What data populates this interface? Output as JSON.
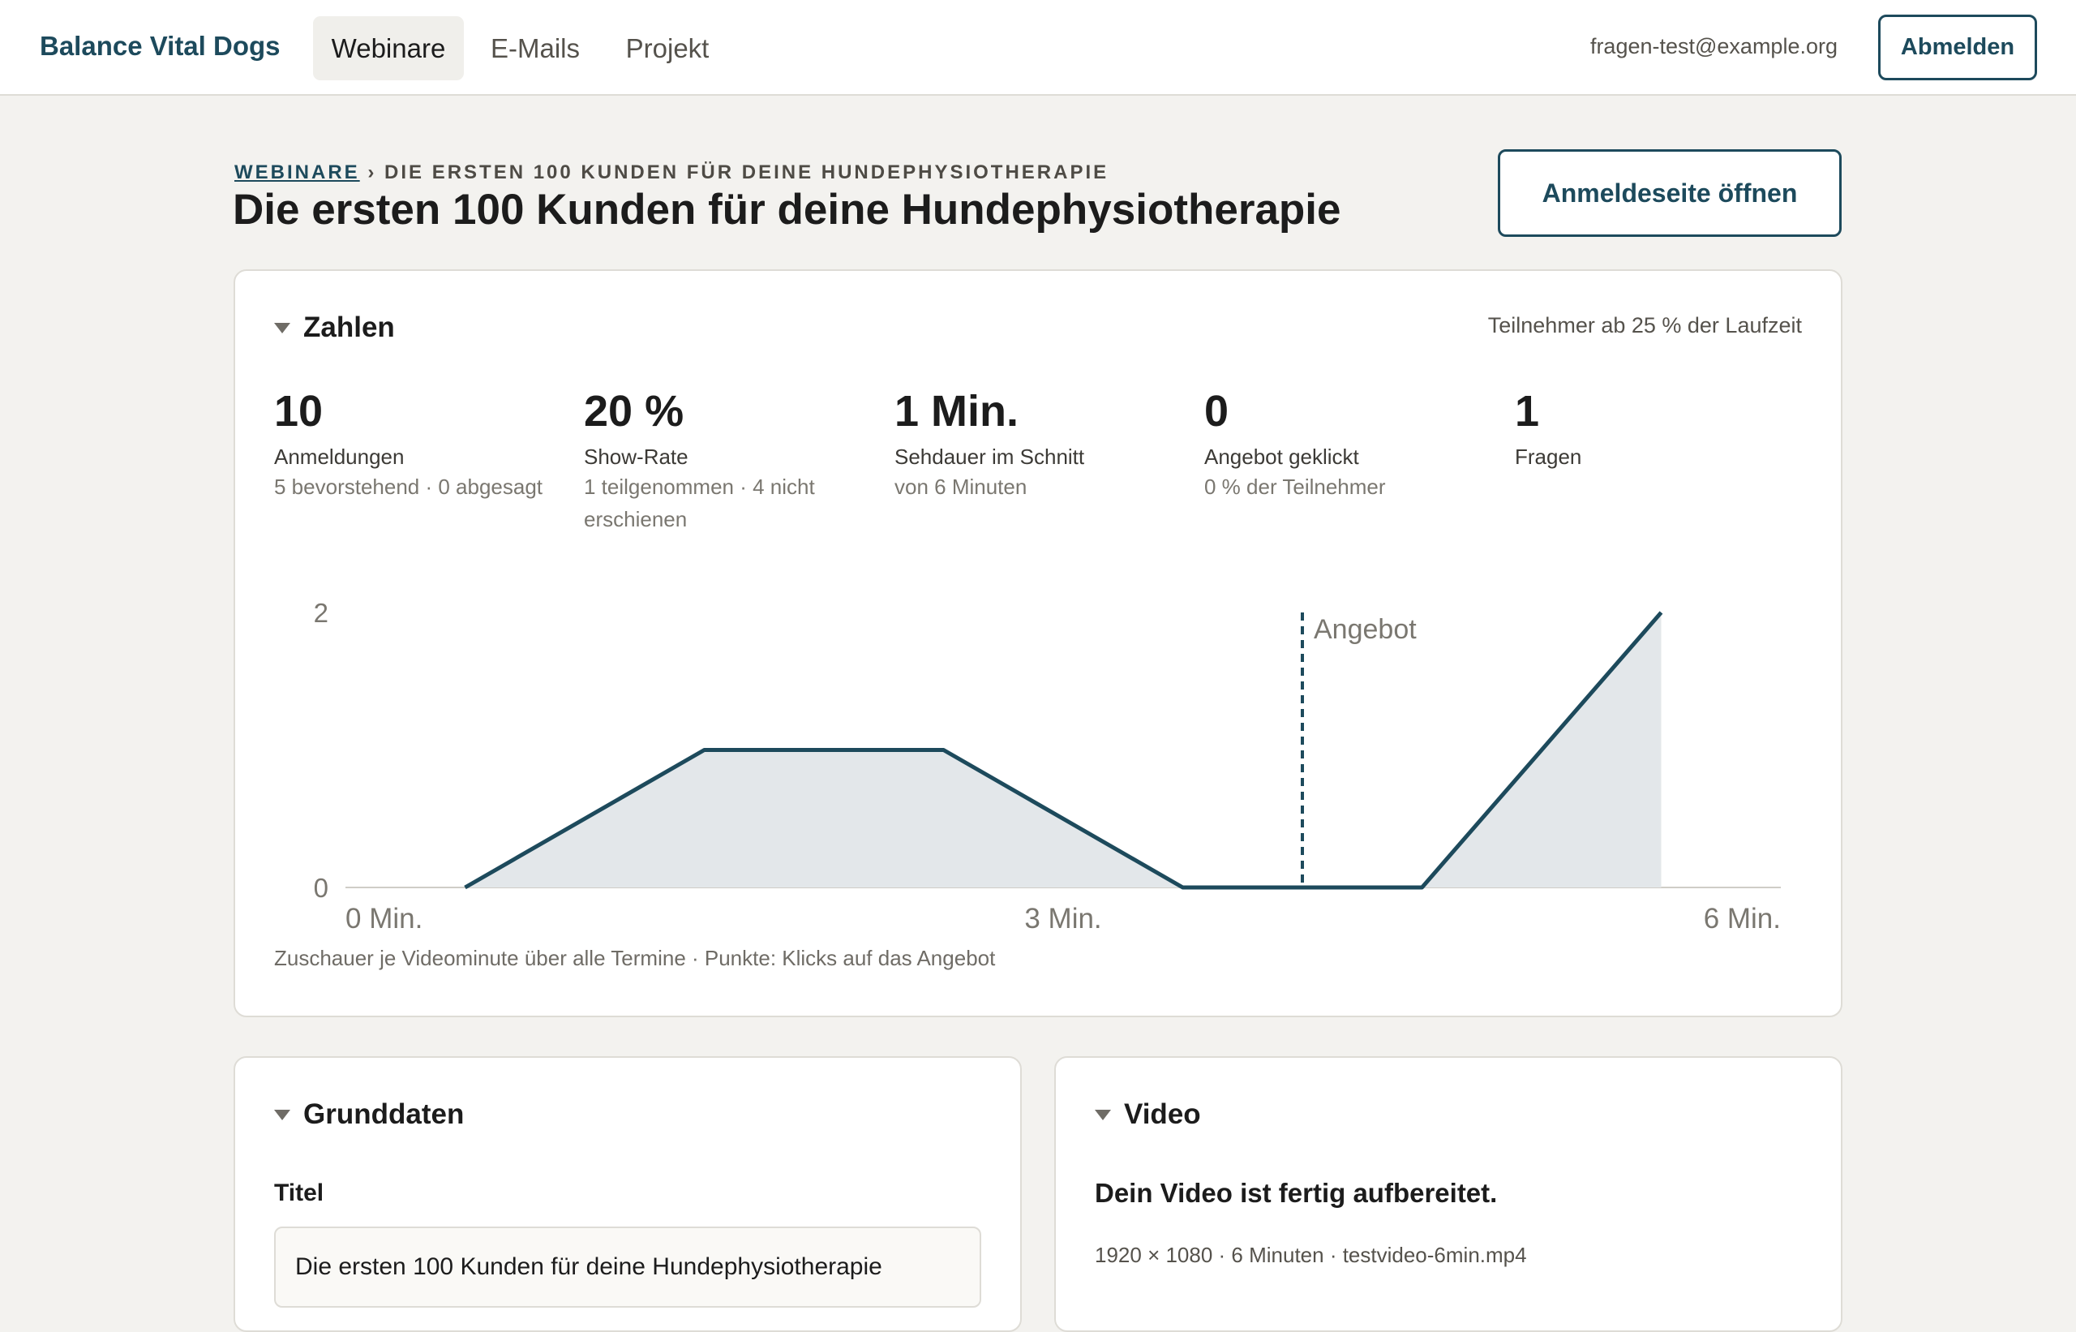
{
  "nav": {
    "brand": "Balance Vital Dogs",
    "tabs": [
      "Webinare",
      "E-Mails",
      "Projekt"
    ],
    "active_tab": "Webinare",
    "user_email": "fragen-test@example.org",
    "logout_label": "Abmelden"
  },
  "header": {
    "breadcrumb_link": "WEBINARE",
    "breadcrumb_sep": "›",
    "breadcrumb_current": "DIE ERSTEN 100 KUNDEN FÜR DEINE HUNDEPHYSIOTHERAPIE",
    "title": "Die ersten 100 Kunden für deine Hundephysiotherapie",
    "open_signup_label": "Anmeldeseite öffnen"
  },
  "stats_card": {
    "title": "Zahlen",
    "note": "Teilnehmer ab 25 % der Laufzeit",
    "stats": [
      {
        "value": "10",
        "label": "Anmeldungen",
        "sub": "5 bevorstehend · 0 abgesagt"
      },
      {
        "value": "20 %",
        "label": "Show-Rate",
        "sub": "1 teilgenommen · 4 nicht erschienen"
      },
      {
        "value": "1 Min.",
        "label": "Sehdauer im Schnitt",
        "sub": "von 6 Minuten"
      },
      {
        "value": "0",
        "label": "Angebot geklickt",
        "sub": "0 % der Teilnehmer"
      },
      {
        "value": "1",
        "label": "Fragen",
        "sub": ""
      }
    ],
    "chart_caption": "Zuschauer je Videominute über alle Termine · Punkte: Klicks auf das Angebot"
  },
  "chart_data": {
    "type": "area",
    "x": [
      0.5,
      1.5,
      2.5,
      3.5,
      4.0,
      4.5,
      5.5
    ],
    "values": [
      0,
      1,
      1,
      0,
      0,
      0,
      2
    ],
    "xlim": [
      0,
      6
    ],
    "ylim": [
      0,
      2
    ],
    "x_ticks": [
      "0 Min.",
      "3 Min.",
      "6 Min."
    ],
    "y_ticks": [
      "0",
      "2"
    ],
    "markers": [
      {
        "x": 4.0,
        "label": "Angebot"
      }
    ],
    "grid": false,
    "colors": {
      "line": "#1d4a5c",
      "fill": "#e3e7ea",
      "axis": "#cfcdc7",
      "tick_text": "#7a7770"
    }
  },
  "basics_card": {
    "title": "Grunddaten",
    "title_field_label": "Titel",
    "title_field_value": "Die ersten 100 Kunden für deine Hundephysiotherapie"
  },
  "video_card": {
    "title": "Video",
    "status": "Dein Video ist fertig aufbereitet.",
    "meta": "1920 × 1080 · 6 Minuten · testvideo-6min.mp4"
  }
}
